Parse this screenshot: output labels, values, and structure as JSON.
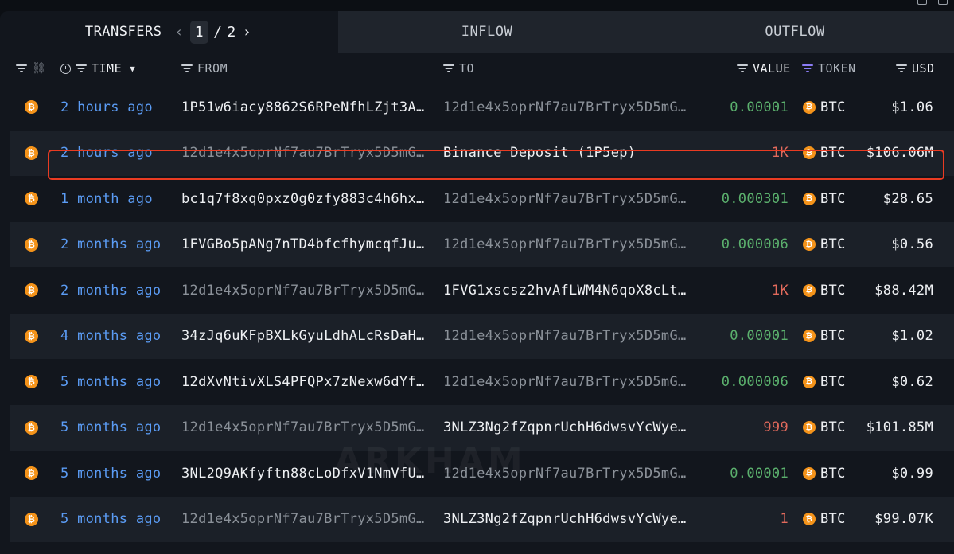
{
  "tabs": {
    "transfers": "TRANSFERS",
    "inflow": "INFLOW",
    "outflow": "OUTFLOW"
  },
  "pagination": {
    "current": "1",
    "separator": "/",
    "total": "2"
  },
  "columns": {
    "time": "TIME",
    "from": "FROM",
    "to": "TO",
    "value": "VALUE",
    "token": "TOKEN",
    "usd": "USD"
  },
  "rows": [
    {
      "time": "2 hours ago",
      "from": "1P51w6iacy8862S6RPeNfhLZjt3A1…",
      "from_dim": false,
      "to": "12d1e4x5oprNf7au7BrTryx5D5mGC…",
      "to_dim": true,
      "value": "0.00001",
      "value_color": "green",
      "token": "BTC",
      "usd": "$1.06"
    },
    {
      "time": "2 hours ago",
      "from": "12d1e4x5oprNf7au7BrTryx5D5mGC…",
      "from_dim": true,
      "to": "Binance Deposit (1P5ep)",
      "to_dim": false,
      "value": "1K",
      "value_color": "red",
      "token": "BTC",
      "usd": "$106.06M"
    },
    {
      "time": "1 month ago",
      "from": "bc1q7f8xq0pxz0g0zfy883c4h6hxt…",
      "from_dim": false,
      "to": "12d1e4x5oprNf7au7BrTryx5D5mGC…",
      "to_dim": true,
      "value": "0.000301",
      "value_color": "green",
      "token": "BTC",
      "usd": "$28.65"
    },
    {
      "time": "2 months ago",
      "from": "1FVGBo5pANg7nTD4bfcfhymcqfJuS…",
      "from_dim": false,
      "to": "12d1e4x5oprNf7au7BrTryx5D5mGC…",
      "to_dim": true,
      "value": "0.000006",
      "value_color": "green",
      "token": "BTC",
      "usd": "$0.56"
    },
    {
      "time": "2 months ago",
      "from": "12d1e4x5oprNf7au7BrTryx5D5mGC…",
      "from_dim": true,
      "to": "1FVG1xscsz2hvAfLWM4N6qoX8cLtB…",
      "to_dim": false,
      "value": "1K",
      "value_color": "red",
      "token": "BTC",
      "usd": "$88.42M"
    },
    {
      "time": "4 months ago",
      "from": "34zJq6uKFpBXLkGyuLdhALcRsDaHg…",
      "from_dim": false,
      "to": "12d1e4x5oprNf7au7BrTryx5D5mGC…",
      "to_dim": true,
      "value": "0.00001",
      "value_color": "green",
      "token": "BTC",
      "usd": "$1.02"
    },
    {
      "time": "5 months ago",
      "from": "12dXvNtivXLS4PFQPx7zNexw6dYfH…",
      "from_dim": false,
      "to": "12d1e4x5oprNf7au7BrTryx5D5mGC…",
      "to_dim": true,
      "value": "0.000006",
      "value_color": "green",
      "token": "BTC",
      "usd": "$0.62"
    },
    {
      "time": "5 months ago",
      "from": "12d1e4x5oprNf7au7BrTryx5D5mGC…",
      "from_dim": true,
      "to": "3NLZ3Ng2fZqpnrUchH6dwsvYcWyeP…",
      "to_dim": false,
      "value": "999",
      "value_color": "red",
      "token": "BTC",
      "usd": "$101.85M"
    },
    {
      "time": "5 months ago",
      "from": "3NL2Q9AKfyftn88cLoDfxV1NmVfUS…",
      "from_dim": false,
      "to": "12d1e4x5oprNf7au7BrTryx5D5mGC…",
      "to_dim": true,
      "value": "0.00001",
      "value_color": "green",
      "token": "BTC",
      "usd": "$0.99"
    },
    {
      "time": "5 months ago",
      "from": "12d1e4x5oprNf7au7BrTryx5D5mGC…",
      "from_dim": true,
      "to": "3NLZ3Ng2fZqpnrUchH6dwsvYcWyeP…",
      "to_dim": false,
      "value": "1",
      "value_color": "red",
      "token": "BTC",
      "usd": "$99.07K"
    }
  ],
  "highlighted_row": 1,
  "colors": {
    "green": "#5bb06d",
    "red": "#e26a5c",
    "time_link": "#5b9cf5",
    "btc": "#f4931a",
    "highlight": "#ea3b22"
  },
  "watermark": "ARKHAM",
  "token_icon": "btc-icon"
}
